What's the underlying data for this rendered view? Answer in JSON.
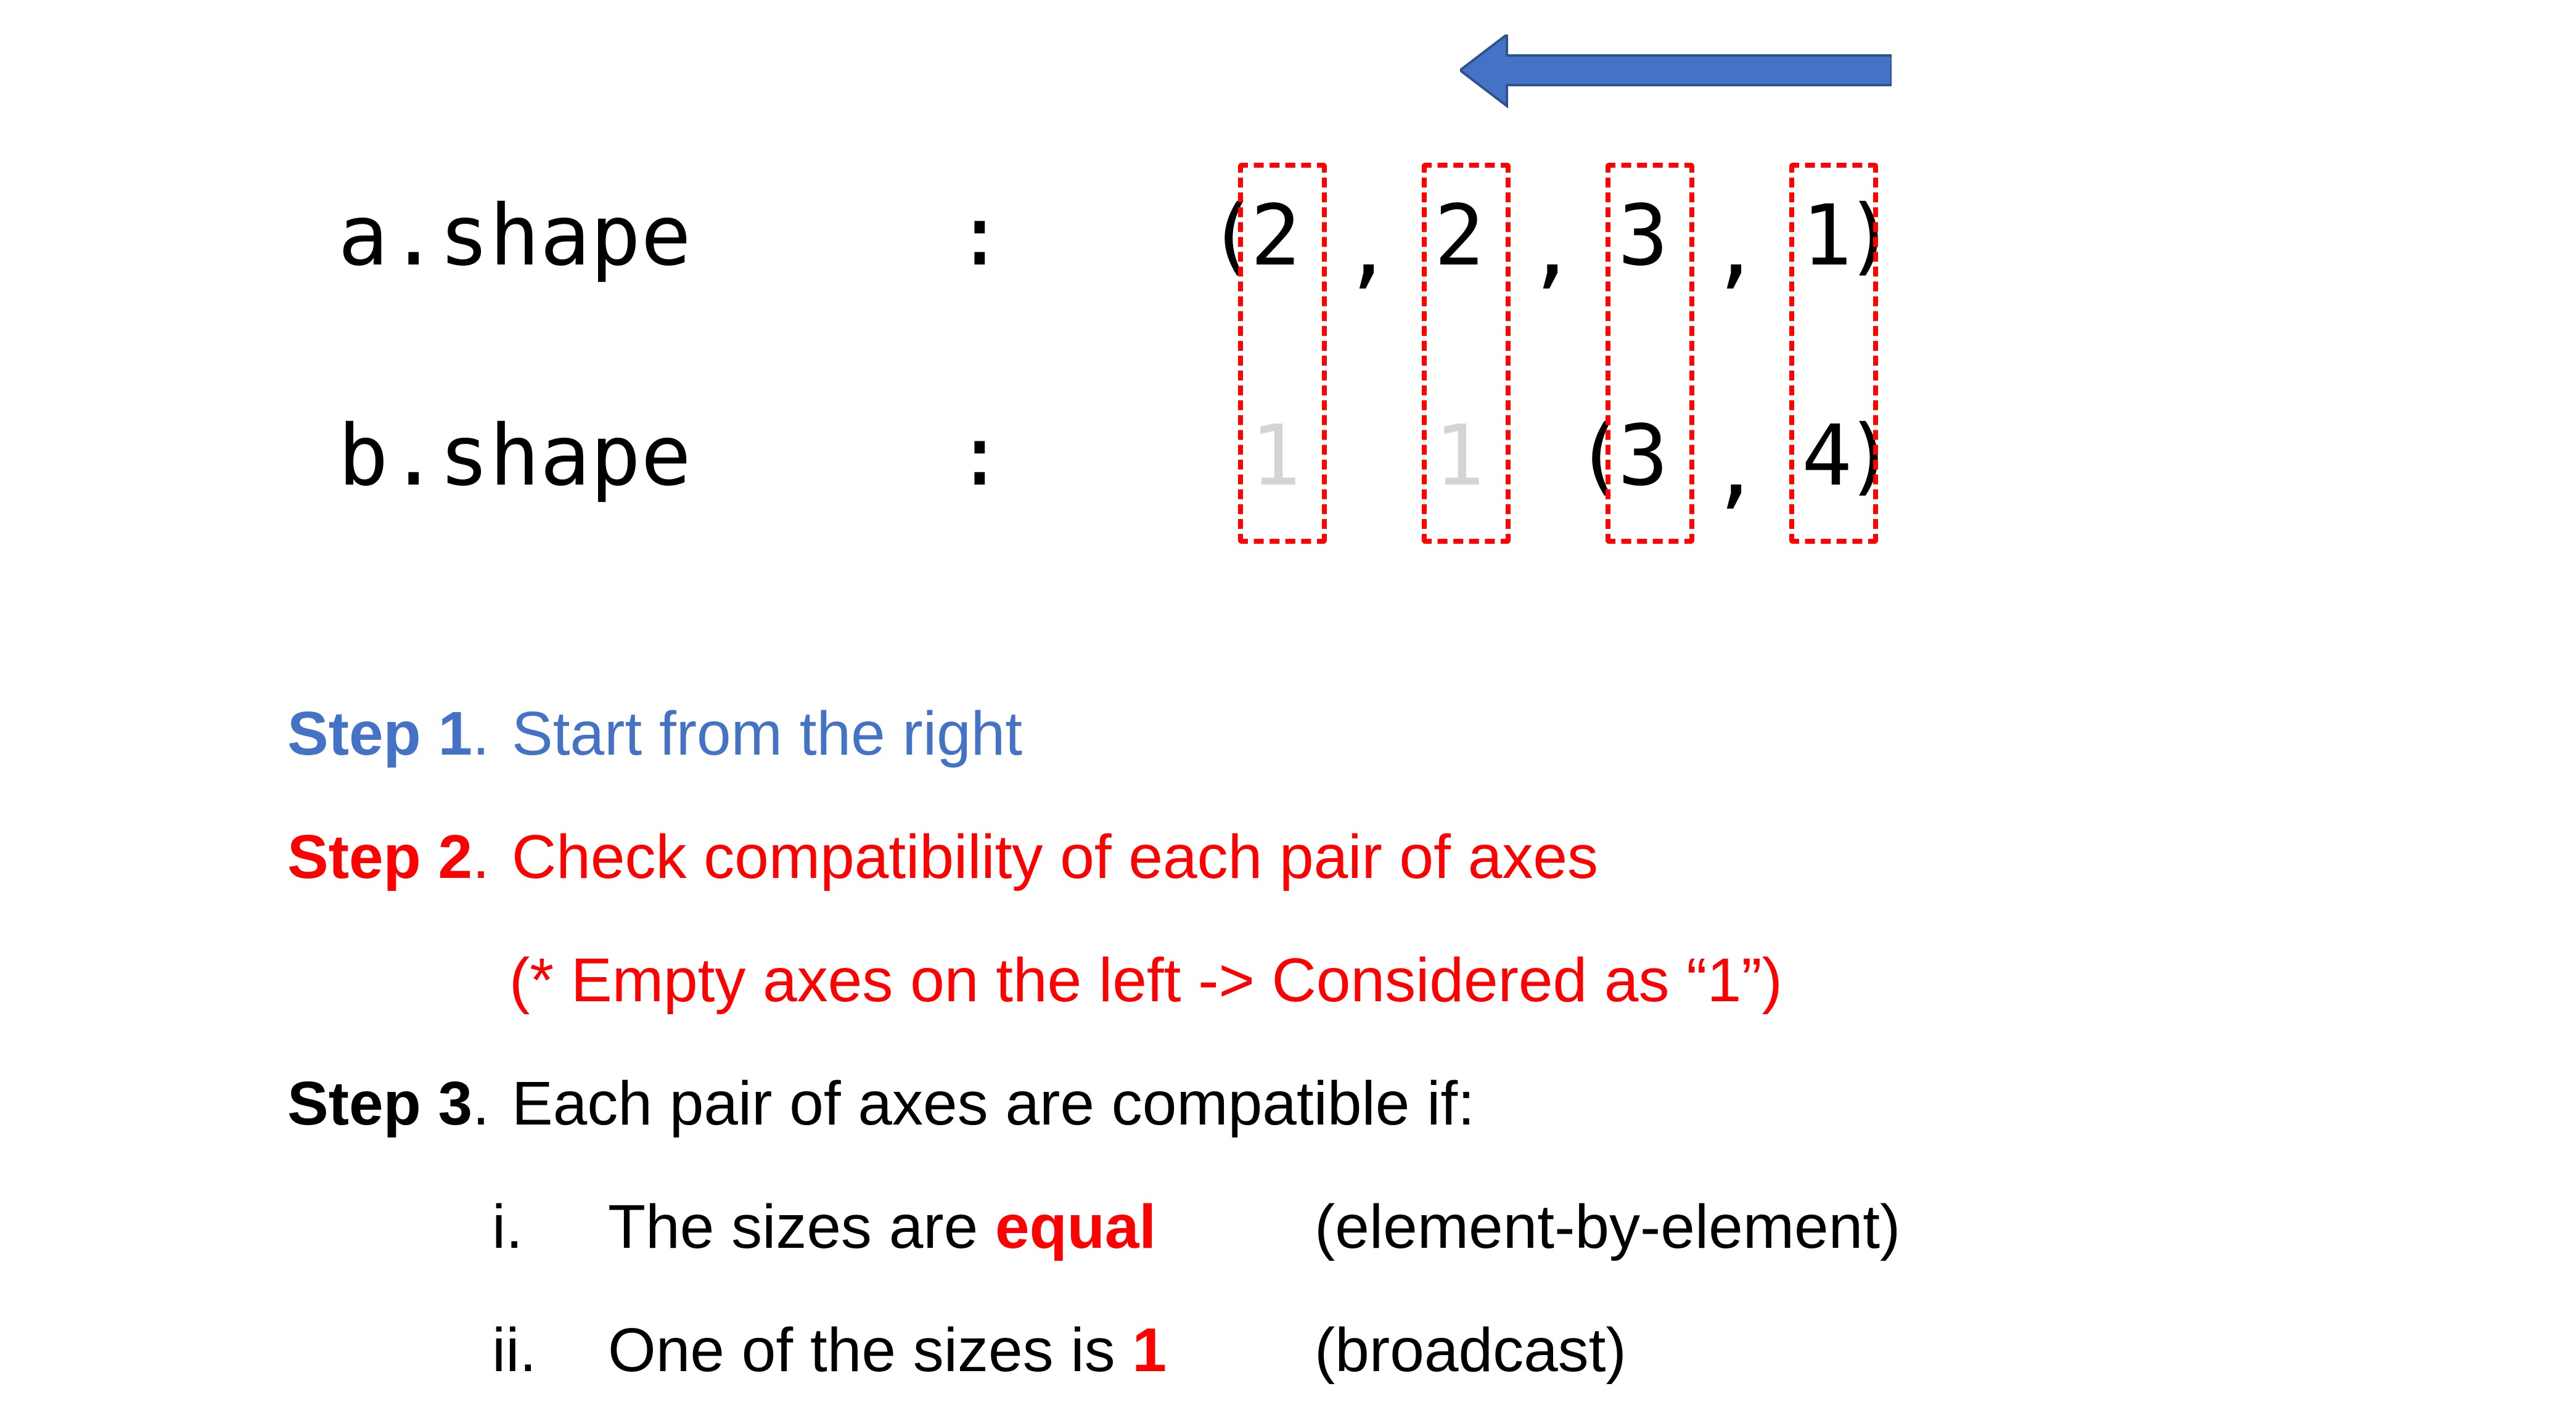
{
  "arrow": {
    "color": "#4472c4",
    "direction": "left"
  },
  "shapes": {
    "a": {
      "label": "a.shape",
      "colon": ":",
      "open": "(",
      "dims": [
        "2",
        "2",
        "3",
        "1"
      ],
      "sep": ",",
      "close": ")"
    },
    "b": {
      "label": "b.shape",
      "colon": ":",
      "implicit": [
        "1",
        "1"
      ],
      "open": "(",
      "dims": [
        "3",
        "4"
      ],
      "sep": ",",
      "close": ")"
    }
  },
  "highlight_color": "#ff0000",
  "steps": {
    "step1": {
      "label": "Step 1",
      "suffix": ".",
      "text": "Start from the right",
      "color": "#4472c4"
    },
    "step2": {
      "label": "Step 2",
      "suffix": ".",
      "text": "Check compatibility of each pair of axes",
      "note": "(* Empty axes on the left -> Considered as “1”)",
      "color": "#ff0000"
    },
    "step3": {
      "label": "Step 3",
      "suffix": ".",
      "text": "Each pair of axes are compatible if:",
      "color": "#000000",
      "conditions": [
        {
          "marker": "i.",
          "text": "The sizes are ",
          "emphasis": "equal",
          "note": "(element-by-element)"
        },
        {
          "marker": "ii.",
          "text": "One of the sizes is ",
          "emphasis": "1",
          "note": "(broadcast)"
        }
      ]
    }
  }
}
